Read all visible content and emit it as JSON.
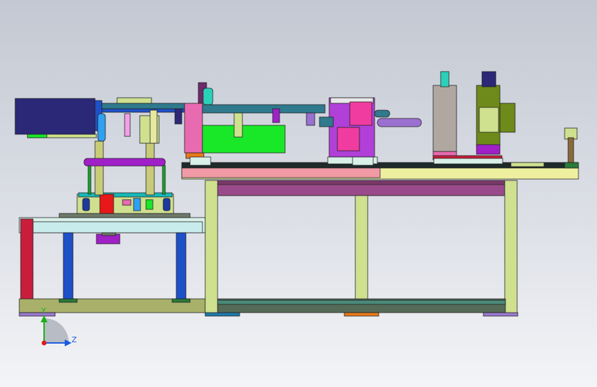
{
  "view": {
    "axis_labels": {
      "y": "Y",
      "z": "Z"
    },
    "colors": {
      "frame": "#cfe08f",
      "frame_dark": "#556b57",
      "leg_red": "#c81e3c",
      "leg_blue": "#1e50c8",
      "motor_navy": "#2b2878",
      "magenta": "#a020c8",
      "pink": "#f03ca0",
      "green": "#18e828",
      "rail_teal": "#2f7a8c",
      "plate_pink": "#f29aa6",
      "olive": "#6e8a1a",
      "axis_y": "#18b018",
      "axis_z": "#1a5ae0",
      "axis_x": "#e01818"
    }
  }
}
